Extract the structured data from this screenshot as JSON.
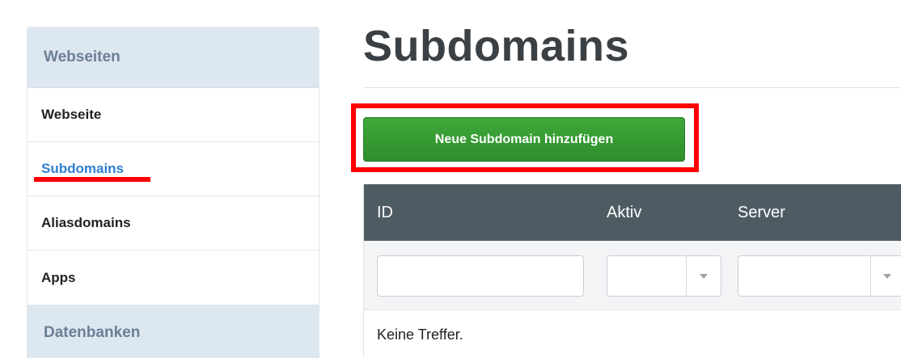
{
  "sidebar": {
    "section1_title": "Webseiten",
    "items": [
      {
        "label": "Webseite"
      },
      {
        "label": "Subdomains"
      },
      {
        "label": "Aliasdomains"
      },
      {
        "label": "Apps"
      }
    ],
    "section2_title": "Datenbanken"
  },
  "main": {
    "title": "Subdomains",
    "add_button_label": "Neue Subdomain hinzufügen",
    "table": {
      "columns": [
        "ID",
        "Aktiv",
        "Server"
      ],
      "filters": {
        "id_value": "",
        "aktiv_selected": "",
        "server_selected": ""
      },
      "empty_message": "Keine Treffer."
    }
  },
  "colors": {
    "active_link": "#2f7fd1",
    "button_green": "#2e8e2b",
    "table_header": "#4f5b63",
    "highlight": "#ff0000"
  }
}
